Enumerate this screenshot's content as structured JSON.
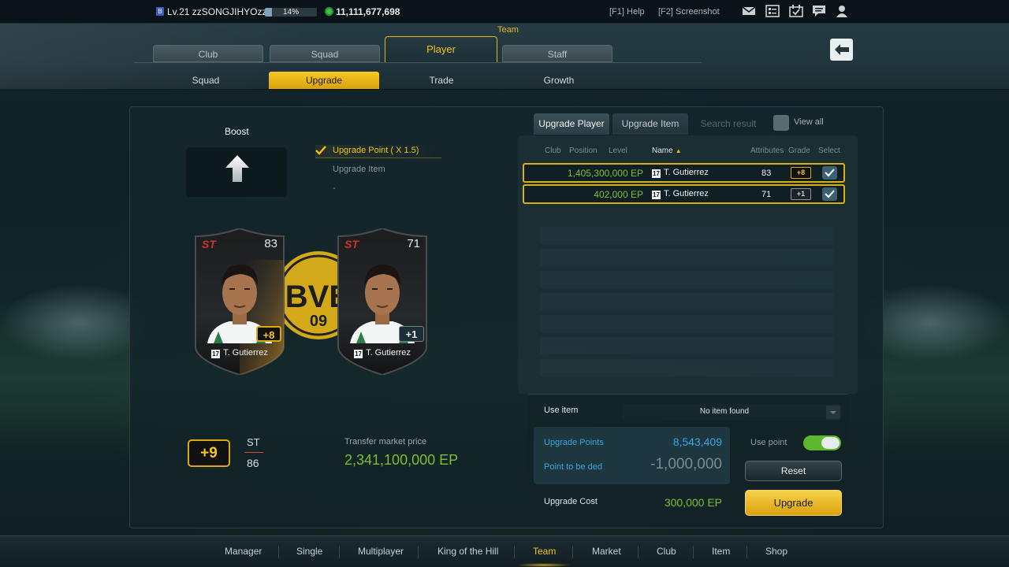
{
  "status": {
    "level_badge": "B",
    "level_user": "Lv.21 zzSONGJIHYOzz",
    "xp_percent": "14%",
    "xp_fraction": 0.14,
    "ep_total": "11,111,677,698",
    "help": "[F1] Help",
    "screenshot": "[F2] Screenshot",
    "icons": [
      "mail-icon",
      "list-icon",
      "calendar-check-icon",
      "chat-icon",
      "profile-icon"
    ]
  },
  "header": {
    "section": "Team",
    "main_tabs": [
      "Club",
      "Squad",
      "Player",
      "Staff"
    ],
    "active_main_tab": "Player",
    "sub_tabs": [
      "Squad",
      "Upgrade",
      "Trade",
      "Growth"
    ],
    "active_sub_tab": "Upgrade"
  },
  "left": {
    "boost_label": "Boost",
    "options": [
      "Upgrade Point ( X 1.5)",
      "Upgrade Item",
      "-"
    ],
    "cards": [
      {
        "position": "ST",
        "ovr": "83",
        "grade": "+8",
        "season": "17",
        "name": "T. Gutierrez"
      },
      {
        "position": "ST",
        "ovr": "71",
        "grade": "+1",
        "season": "17",
        "name": "T. Gutierrez"
      }
    ],
    "crest_text": "BVB 09",
    "result": {
      "grade": "+9",
      "position": "ST",
      "ovr": "86",
      "transfer_label": "Transfer market price",
      "transfer_value": "2,341,100,000 EP"
    }
  },
  "right": {
    "tabs": [
      "Upgrade Player",
      "Upgrade Item",
      "Search result"
    ],
    "view_all": "View all",
    "columns": [
      "Club",
      "Position",
      "Level",
      "Name",
      "Attributes",
      "Grade",
      "Select"
    ],
    "rows": [
      {
        "price": "1,405,300,000 EP",
        "season": "17",
        "name": "T. Gutierrez",
        "attributes": "83",
        "grade": "+8"
      },
      {
        "price": "402,000 EP",
        "season": "17",
        "name": "T. Gutierrez",
        "attributes": "71",
        "grade": "+1"
      }
    ],
    "use_item_label": "Use item",
    "use_item_value": "No item found",
    "upgrade_points_label": "Upgrade Points",
    "upgrade_points_value": "8,543,409",
    "point_deducted_label": "Point to be ded",
    "point_deducted_value": "-1,000,000",
    "use_point_label": "Use point",
    "use_point_on": true,
    "reset_label": "Reset",
    "cost_label": "Upgrade Cost",
    "cost_value": "300,000 EP",
    "upgrade_label": "Upgrade"
  },
  "bottom_nav": {
    "items": [
      "Manager",
      "Single",
      "Multiplayer",
      "King of the Hill",
      "Team",
      "Market",
      "Club",
      "Item",
      "Shop"
    ],
    "active": "Team"
  },
  "colors": {
    "accent_gold": "#f1c21f",
    "ep_green": "#7bbf2f",
    "points_blue": "#35a8e0",
    "position_red": "#d0312d"
  }
}
